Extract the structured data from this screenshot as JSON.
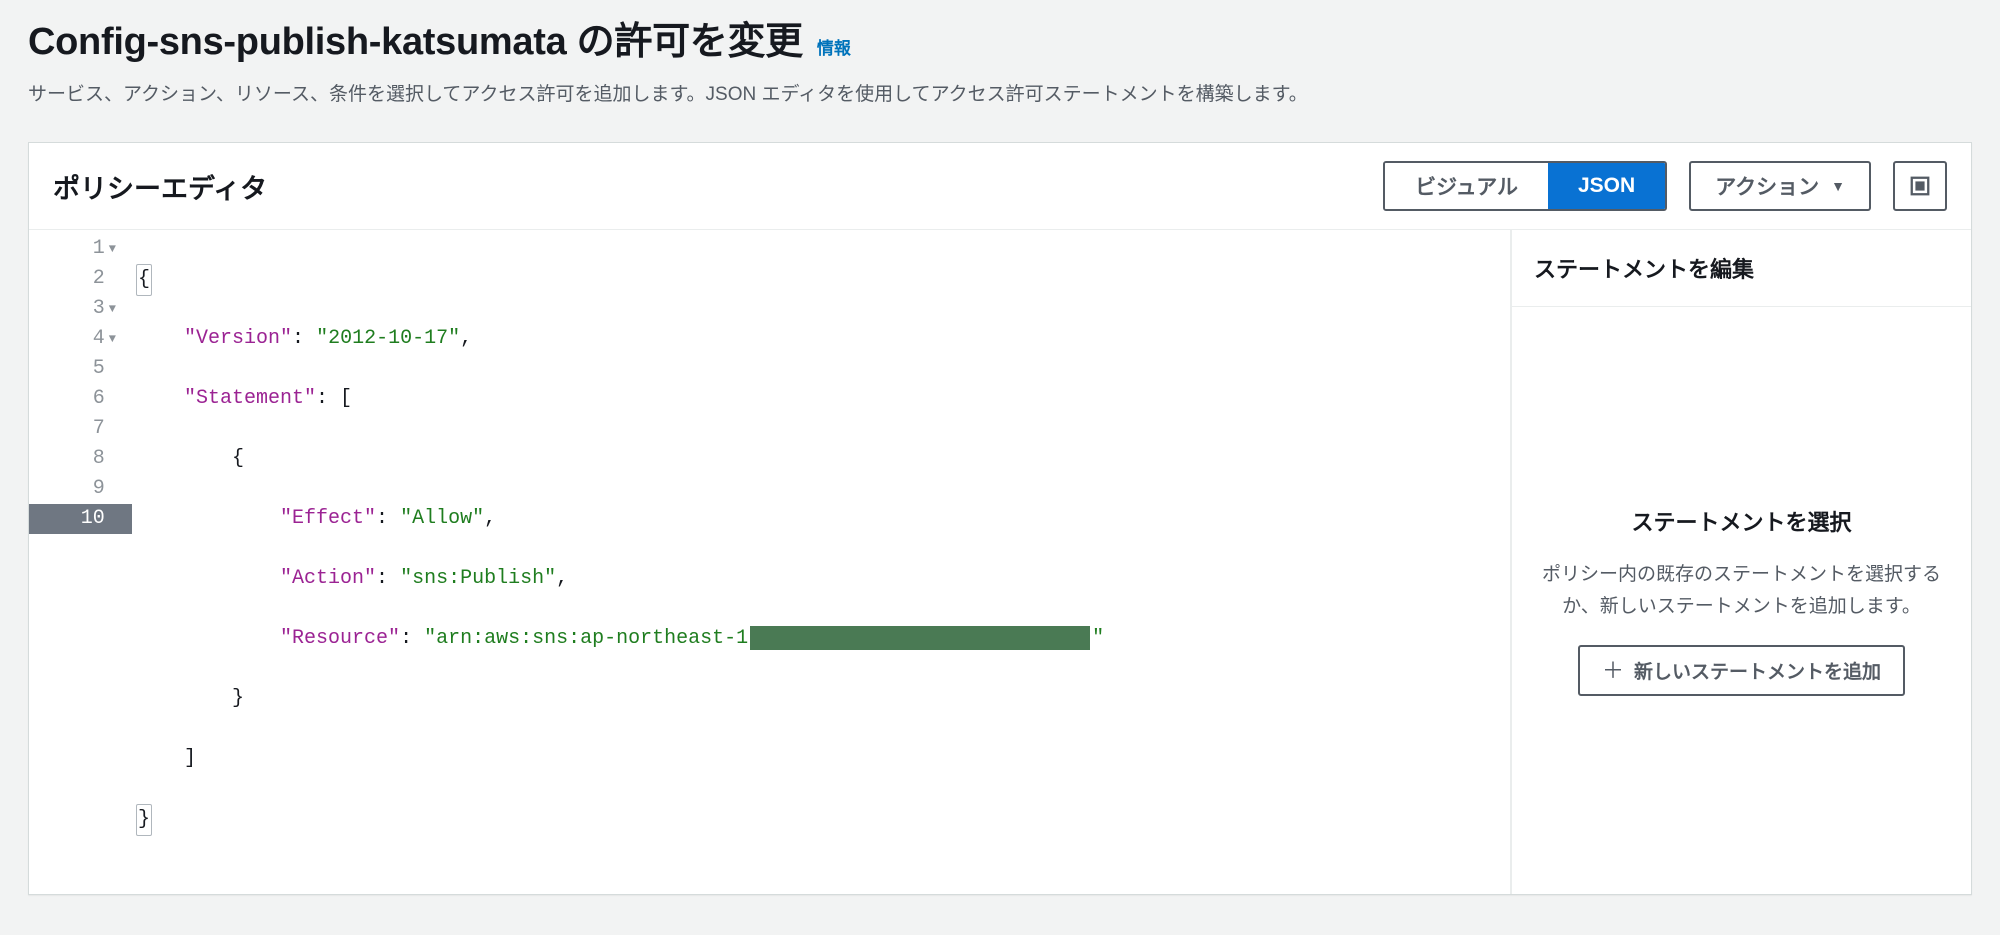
{
  "header": {
    "title": "Config-sns-publish-katsumata の許可を変更",
    "info_link": "情報",
    "description": "サービス、アクション、リソース、条件を選択してアクセス許可を追加します。JSON エディタを使用してアクセス許可ステートメントを構築します。"
  },
  "panel": {
    "title": "ポリシーエディタ",
    "toggle": {
      "visual": "ビジュアル",
      "json": "JSON",
      "active": "json"
    },
    "actions_label": "アクション"
  },
  "editor": {
    "line_numbers": [
      "1",
      "2",
      "3",
      "4",
      "5",
      "6",
      "7",
      "8",
      "9",
      "10"
    ],
    "foldable_lines": [
      1,
      3,
      4
    ],
    "current_line": 10,
    "json": {
      "Version": "2012-10-17",
      "Statement": [
        {
          "Effect": "Allow",
          "Action": "sns:Publish",
          "Resource": "arn:aws:sns:ap-northeast-1"
        }
      ]
    },
    "resource_redacted": true
  },
  "side": {
    "header": "ステートメントを編集",
    "empty_title": "ステートメントを選択",
    "empty_desc": "ポリシー内の既存のステートメントを選択するか、新しいステートメントを追加します。",
    "add_button": "新しいステートメントを追加"
  }
}
